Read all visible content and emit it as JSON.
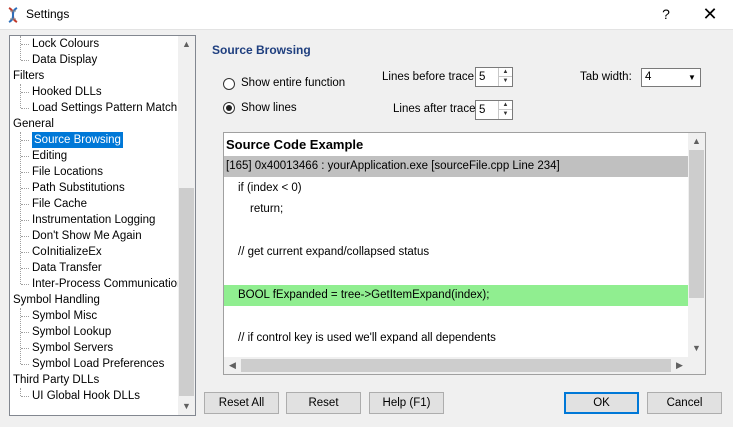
{
  "window": {
    "title": "Settings",
    "help_glyph": "?",
    "close_glyph": "✕"
  },
  "tree": {
    "items": [
      {
        "label": "Lock Colours",
        "level": 1
      },
      {
        "label": "Data Display",
        "level": 1
      },
      {
        "label": "Filters",
        "level": 0
      },
      {
        "label": "Hooked DLLs",
        "level": 1
      },
      {
        "label": "Load Settings Pattern Match",
        "level": 1
      },
      {
        "label": "General",
        "level": 0
      },
      {
        "label": "Source Browsing",
        "level": 1,
        "selected": true
      },
      {
        "label": "Editing",
        "level": 1
      },
      {
        "label": "File Locations",
        "level": 1
      },
      {
        "label": "Path Substitutions",
        "level": 1
      },
      {
        "label": "File Cache",
        "level": 1
      },
      {
        "label": "Instrumentation Logging",
        "level": 1
      },
      {
        "label": "Don't Show Me Again",
        "level": 1
      },
      {
        "label": "CoInitializeEx",
        "level": 1
      },
      {
        "label": "Data Transfer",
        "level": 1
      },
      {
        "label": "Inter-Process Communication",
        "level": 1
      },
      {
        "label": "Symbol Handling",
        "level": 0
      },
      {
        "label": "Symbol Misc",
        "level": 1
      },
      {
        "label": "Symbol Lookup",
        "level": 1
      },
      {
        "label": "Symbol Servers",
        "level": 1
      },
      {
        "label": "Symbol Load Preferences",
        "level": 1
      },
      {
        "label": "Third Party DLLs",
        "level": 0
      },
      {
        "label": "UI Global Hook DLLs",
        "level": 1
      }
    ]
  },
  "source_browsing": {
    "title": "Source Browsing",
    "show_entire_function": "Show entire function",
    "show_lines": "Show lines",
    "selected_option": "Show lines",
    "lines_before_label": "Lines before trace",
    "lines_before_value": "5",
    "lines_after_label": "Lines after trace",
    "lines_after_value": "5",
    "tab_width_label": "Tab width:",
    "tab_width_value": "4"
  },
  "code_example": {
    "title": "Source Code Example",
    "lines": [
      {
        "text": "[165] 0x40013466 : yourApplication.exe [sourceFile.cpp Line 234]",
        "style": "header",
        "indent": 0
      },
      {
        "text": "if (index < 0)",
        "style": "normal",
        "indent": 1
      },
      {
        "text": "return;",
        "style": "normal",
        "indent": 2
      },
      {
        "text": "",
        "style": "normal",
        "indent": 0
      },
      {
        "text": "// get current expand/collapsed status",
        "style": "normal",
        "indent": 1
      },
      {
        "text": "",
        "style": "normal",
        "indent": 0
      },
      {
        "text": "BOOL fExpanded = tree->GetItemExpand(index);",
        "style": "highlight",
        "indent": 1
      },
      {
        "text": "",
        "style": "normal",
        "indent": 0
      },
      {
        "text": "// if control key is used we'll expand all dependents",
        "style": "normal",
        "indent": 1
      }
    ],
    "highlight_color": "#90ee90",
    "header_color": "#c0c0c0"
  },
  "buttons": {
    "reset_all": "Reset All",
    "reset": "Reset",
    "help": "Help (F1)",
    "ok": "OK",
    "cancel": "Cancel"
  },
  "colors": {
    "selection": "#0078d7",
    "section_title": "#1f3f7f"
  }
}
